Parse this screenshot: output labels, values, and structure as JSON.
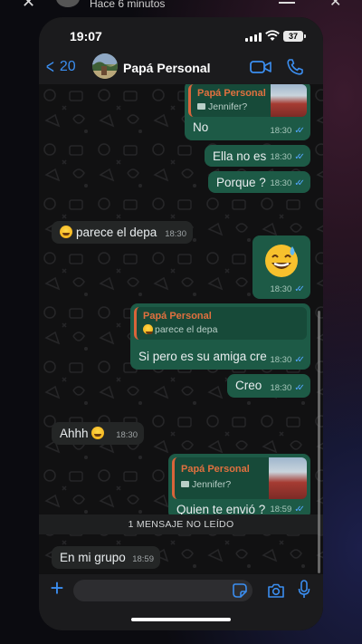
{
  "story": {
    "time_label": "Hace 6 minutos"
  },
  "status": {
    "time": "19:07",
    "battery": "37"
  },
  "header": {
    "back_count": "20",
    "contact_name": "Papá Personal"
  },
  "messages": [
    {
      "type": "reply",
      "dir": "out",
      "quote_name": "Papá Personal",
      "quote_text": "Jennifer?",
      "text": "No",
      "time": "18:30"
    },
    {
      "type": "text",
      "dir": "out",
      "text": "Ella no es",
      "time": "18:30"
    },
    {
      "type": "text",
      "dir": "out",
      "text": "Porque ?",
      "time": "18:30"
    },
    {
      "type": "text",
      "dir": "in",
      "text": "parece el depa",
      "time": "18:30"
    },
    {
      "type": "emoji",
      "dir": "out",
      "time": "18:30"
    },
    {
      "type": "reply",
      "dir": "out",
      "quote_name": "Papá Personal",
      "quote_text": "parece el depa",
      "text": "Si pero es su amiga cre",
      "time": "18:30"
    },
    {
      "type": "text",
      "dir": "out",
      "text": "Creo",
      "time": "18:30"
    },
    {
      "type": "text",
      "dir": "in",
      "text": "Ahhh",
      "time": "18:30"
    },
    {
      "type": "reply",
      "dir": "out",
      "quote_name": "Papá Personal",
      "quote_text": "Jennifer?",
      "text": "Quien te envió ?",
      "time": "18:59"
    },
    {
      "type": "text",
      "dir": "in",
      "text": "En mi grupo",
      "time": "18:59"
    }
  ],
  "unread_banner": "1 MENSAJE NO LEÍDO",
  "composer": {
    "placeholder": ""
  },
  "colors": {
    "accent": "#3b8ef0",
    "outgoing_bubble": "#1d5a46",
    "incoming_bubble": "#242626",
    "read_ticks": "#53a6ff",
    "quote_name": "#e0703f"
  },
  "icons": [
    "back-chevron-icon",
    "video-call-icon",
    "phone-call-icon",
    "plus-icon",
    "sticker-icon",
    "camera-icon",
    "microphone-icon",
    "read-ticks-icon"
  ]
}
